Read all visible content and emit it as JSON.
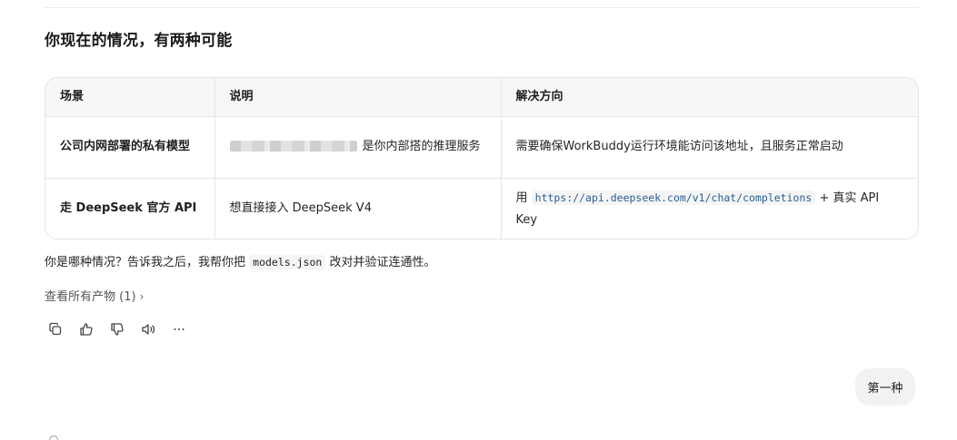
{
  "heading": "你现在的情况，有两种可能",
  "table": {
    "headers": [
      "场景",
      "说明",
      "解决方向"
    ],
    "rows": [
      {
        "scenario": "公司内网部署的私有模型",
        "description_suffix": "是你内部搭的推理服务",
        "solution": "需要确保WorkBuddy运行环境能访问该地址，且服务正常启动"
      },
      {
        "scenario": "走 DeepSeek 官方 API",
        "description": "想直接接入 DeepSeek V4",
        "solution_prefix": "用",
        "solution_code": "https://api.deepseek.com/v1/chat/completions",
        "solution_suffix": "+ 真实 API Key"
      }
    ]
  },
  "question": {
    "prefix": "你是哪种情况？告诉我之后，我帮你把",
    "code": "models.json",
    "suffix": "改对并验证连通性。"
  },
  "artifacts_link": "查看所有产物 (1)",
  "actions": {
    "copy": "copy-icon",
    "like": "thumbs-up-icon",
    "dislike": "thumbs-down-icon",
    "read_aloud": "speaker-icon",
    "more": "more-icon"
  },
  "user_message": "第一种"
}
